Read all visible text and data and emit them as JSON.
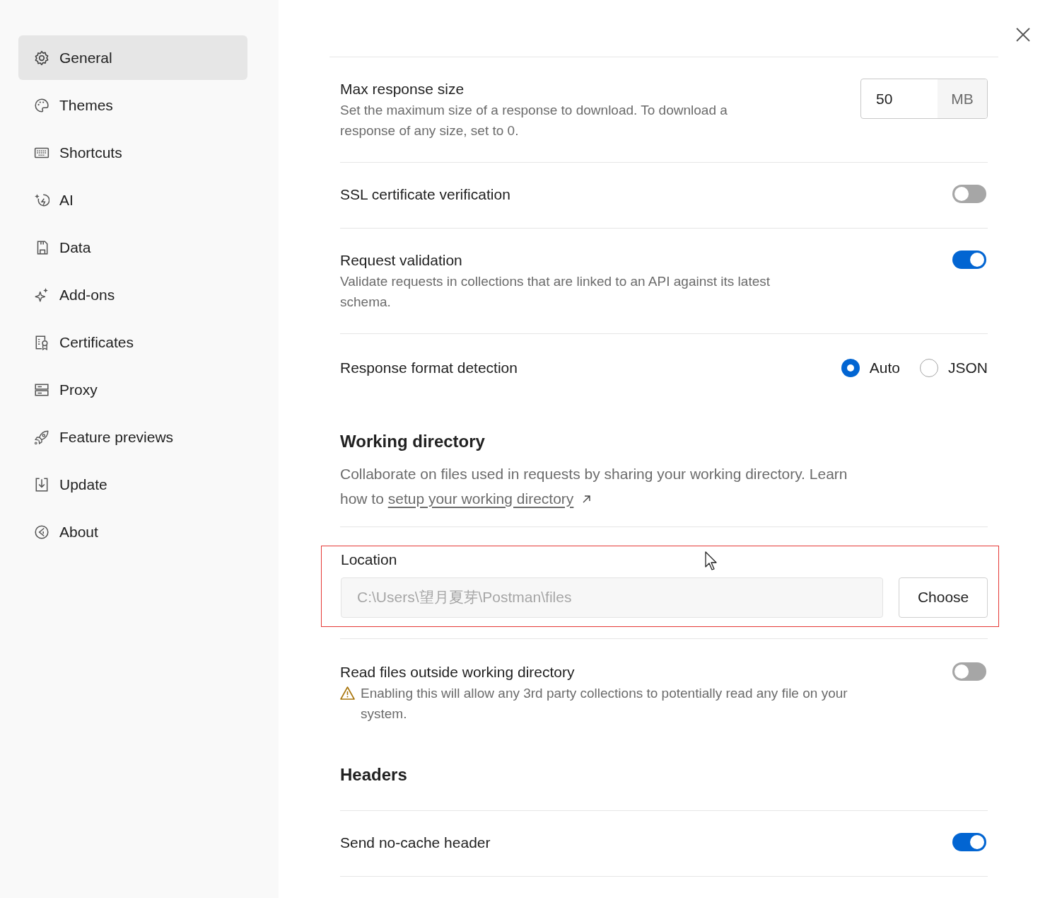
{
  "sidebar": {
    "items": [
      {
        "label": "General",
        "selected": true
      },
      {
        "label": "Themes",
        "selected": false
      },
      {
        "label": "Shortcuts",
        "selected": false
      },
      {
        "label": "AI",
        "selected": false
      },
      {
        "label": "Data",
        "selected": false
      },
      {
        "label": "Add-ons",
        "selected": false
      },
      {
        "label": "Certificates",
        "selected": false
      },
      {
        "label": "Proxy",
        "selected": false
      },
      {
        "label": "Feature previews",
        "selected": false
      },
      {
        "label": "Update",
        "selected": false
      },
      {
        "label": "About",
        "selected": false
      }
    ]
  },
  "settings": [
    {
      "kind": "number",
      "title": "Max response size",
      "description": "Set the maximum size of a response to download. To download a response of any size, set to 0.",
      "value": "50",
      "unit": "MB"
    },
    {
      "kind": "toggle",
      "title": "SSL certificate verification",
      "on": false
    },
    {
      "kind": "toggle",
      "title": "Request validation",
      "description": "Validate requests in collections that are linked to an API against its latest schema.",
      "on": true
    },
    {
      "kind": "radio",
      "title": "Response format detection",
      "options": [
        {
          "label": "Auto",
          "selected": true
        },
        {
          "label": "JSON",
          "selected": false
        }
      ]
    },
    {
      "kind": "heading",
      "title": "Working directory",
      "description": "Collaborate on files used in requests by sharing your working directory. Learn how to",
      "link": "setup your working directory"
    },
    {
      "kind": "location",
      "label": "Location",
      "value": "C:\\Users\\望月夏芽\\Postman\\files",
      "disabled": true,
      "button": "Choose",
      "highlighted": true
    },
    {
      "kind": "toggle",
      "title": "Read files outside working directory",
      "warning": "Enabling this will allow any 3rd party collections to potentially read any file on your system.",
      "on": false
    },
    {
      "kind": "heading",
      "title": "Headers"
    },
    {
      "kind": "toggle",
      "title": "Send no-cache header",
      "on": true
    }
  ]
}
